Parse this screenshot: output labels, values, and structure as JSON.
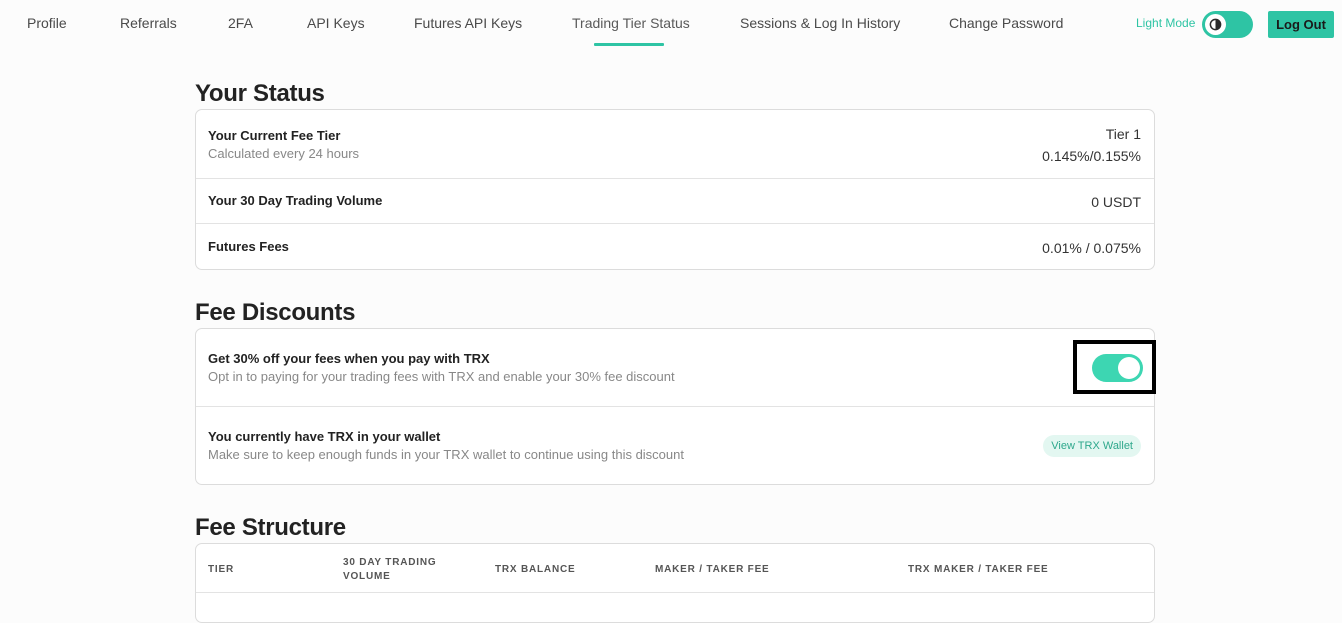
{
  "nav": {
    "tabs": [
      {
        "label": "Profile"
      },
      {
        "label": "Referrals"
      },
      {
        "label": "2FA"
      },
      {
        "label": "API Keys"
      },
      {
        "label": "Futures API Keys"
      },
      {
        "label": "Trading Tier Status"
      },
      {
        "label": "Sessions & Log In History"
      },
      {
        "label": "Change Password"
      }
    ],
    "active_tab": "Trading Tier Status",
    "light_mode_label": "Light Mode",
    "logout_label": "Log Out"
  },
  "status": {
    "title": "Your Status",
    "rows": [
      {
        "title": "Your Current Fee Tier",
        "subtitle": "Calculated every 24 hours",
        "value": "Tier 1",
        "value2": "0.145%/0.155%"
      },
      {
        "title": "Your 30 Day Trading Volume",
        "value": "0 USDT"
      },
      {
        "title": "Futures Fees",
        "value": "0.01% / 0.075%"
      }
    ]
  },
  "discounts": {
    "title": "Fee Discounts",
    "rows": [
      {
        "title": "Get 30% off your fees when you pay with TRX",
        "subtitle": "Opt in to paying for your trading fees with TRX and enable your 30% fee discount",
        "toggle_on": true
      },
      {
        "title": "You currently have TRX in your wallet",
        "subtitle": "Make sure to keep enough funds in your TRX wallet to continue using this discount",
        "button_label": "View TRX Wallet"
      }
    ]
  },
  "structure": {
    "title": "Fee Structure",
    "columns": [
      "TIER",
      "30 DAY TRADING VOLUME",
      "TRX BALANCE",
      "MAKER / TAKER FEE",
      "TRX MAKER / TAKER FEE"
    ]
  },
  "colors": {
    "accent": "#2ec4a4",
    "background": "#fcfcfc"
  }
}
